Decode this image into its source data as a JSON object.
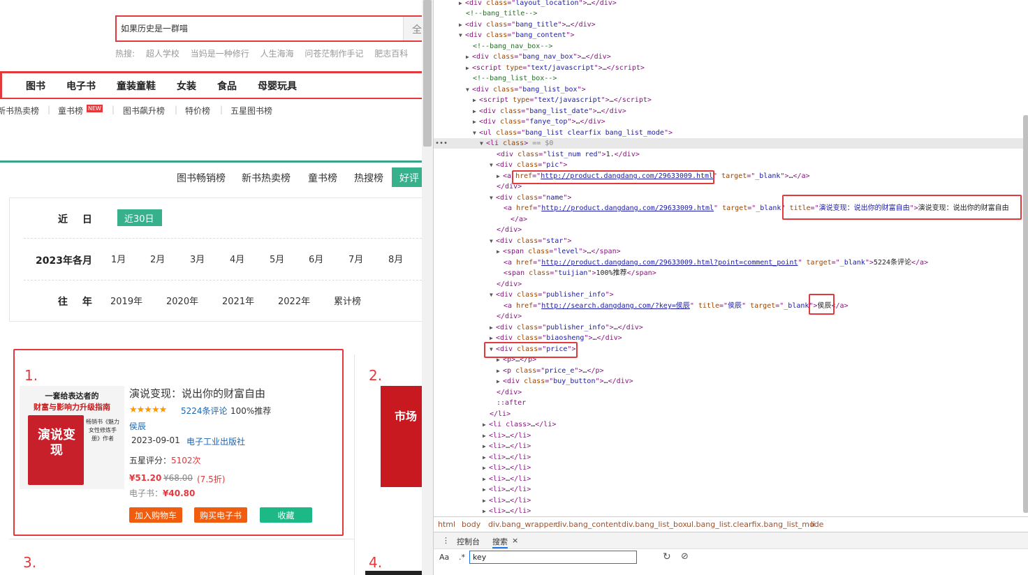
{
  "search": {
    "value": "如果历史是一群喵",
    "button": "全"
  },
  "hot_searches": {
    "label": "热搜:",
    "items": [
      "超人学校",
      "当妈是一种修行",
      "人生海海",
      "问苍茫制作手记",
      "肥志百科"
    ]
  },
  "nav": {
    "items": [
      "图书",
      "电子书",
      "童装童鞋",
      "女装",
      "食品",
      "母婴玩具"
    ]
  },
  "subnav": {
    "items": [
      "新书热卖榜",
      "童书榜",
      "图书飙升榜",
      "特价榜",
      "五星图书榜"
    ],
    "badge": "NEW"
  },
  "rank_tabs": {
    "items": [
      "图书畅销榜",
      "新书热卖榜",
      "童书榜",
      "热搜榜"
    ],
    "active": "好评"
  },
  "filter": {
    "recent_label": "近 日",
    "recent_selected": "近30日",
    "months_label": "2023年各月",
    "months": [
      "1月",
      "2月",
      "3月",
      "4月",
      "5月",
      "6月",
      "7月",
      "8月"
    ],
    "years_label": "往 年",
    "years": [
      "2019年",
      "2020年",
      "2021年",
      "2022年",
      "累计榜"
    ]
  },
  "book": {
    "rank": "1.",
    "cover_line1": "一套给表达者的",
    "cover_line2": "财富与影响力升级指南",
    "cover_title": "演说变现",
    "cover_side": "畅销书《魅力女性修炼手册》作者",
    "title": "演说变现：说出你的财富自由",
    "stars": "★★★★★",
    "comments": "5224条评论",
    "recommend": "100%推荐",
    "author": "侯辰",
    "date": "2023-09-01",
    "publisher": "电子工业出版社",
    "score_label": "五星评分：",
    "score_value": "5102次",
    "price": "¥51.20",
    "price_old": "¥68.00",
    "discount": "(7.5折)",
    "ebook_label": "电子书：",
    "ebook_price": "¥40.80",
    "btn_cart": "加入购物车",
    "btn_ebuy": "购买电子书",
    "btn_fav": "收藏"
  },
  "book2": {
    "rank": "2.",
    "cover": "市场"
  },
  "book3": {
    "rank": "3."
  },
  "book4": {
    "rank": "4."
  },
  "dom": {
    "l0": {
      "tag": "div",
      "cls": "layout_location"
    },
    "l1": "<!--bang_title-->",
    "l2": {
      "cls": "bang_title"
    },
    "l3": {
      "cls": "bang_content"
    },
    "l4": "<!--bang_nav_box-->",
    "l5": {
      "cls": "bang_nav_box"
    },
    "l6": {
      "type": "text/javascript"
    },
    "l7": "<!--bang_list_box-->",
    "l8": {
      "cls": "bang_list_box"
    },
    "l9": {
      "type": "text/javascript"
    },
    "l10": {
      "cls": "bang_list_date"
    },
    "l11": {
      "cls": "fanye_top"
    },
    "l12": {
      "cls": "bang_list clearfix bang_list_mode"
    },
    "l13": {
      "suffix": "== $0"
    },
    "l14": {
      "cls": "list_num red",
      "text": "1."
    },
    "l15": {
      "cls": "pic"
    },
    "l16": {
      "href": "http://product.dangdang.com/29633009.html",
      "target": "_blank"
    },
    "l18": {
      "cls": "name"
    },
    "l19": {
      "href": "http://product.dangdang.com/29633009.html",
      "target": "_blank",
      "title": "演说变现：说出你的财富自由",
      "text": "演说变现：说出你的财富自由"
    },
    "l22": {
      "cls": "star"
    },
    "l23": {
      "cls": "level"
    },
    "l24": {
      "href": "http://product.dangdang.com/29633009.html?point=comment_point",
      "target": "_blank",
      "text": "5224条评论"
    },
    "l25": {
      "cls": "tuijian",
      "text": "100%推荐"
    },
    "l27": {
      "cls": "publisher_info"
    },
    "l28": {
      "href": "http://search.dangdang.com/?key=侯辰",
      "title": "侯辰",
      "target": "_blank",
      "text": "侯辰"
    },
    "l30": {
      "cls": "publisher_info"
    },
    "l31": {
      "cls": "biaosheng"
    },
    "l32": {
      "cls": "price"
    },
    "l34": {
      "cls": "price_e"
    },
    "l35": {
      "cls": "buy_button"
    },
    "l37": "::after",
    "l39": {
      "cls": "li class"
    }
  },
  "crumbs": [
    "html",
    "body",
    "div.bang_wrapper",
    "div.bang_content",
    "div.bang_list_box",
    "ul.bang_list.clearfix.bang_list_mode",
    "li"
  ],
  "drawer": {
    "tabs": [
      "控制台",
      "搜索"
    ],
    "close": "×"
  },
  "search_panel": {
    "case": "Aa",
    "regex": ".*",
    "value": "key"
  },
  "colors": {
    "accent": "#e3393c",
    "green": "#37b08c",
    "orange": "#f05d0e"
  }
}
